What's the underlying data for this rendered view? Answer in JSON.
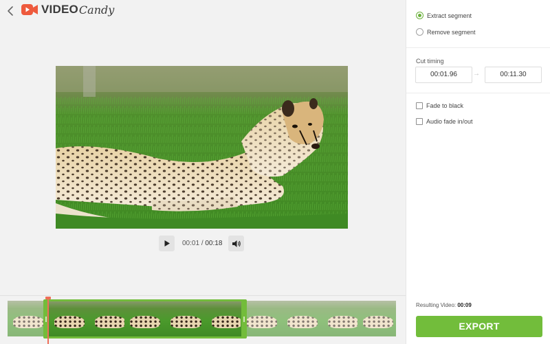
{
  "app": {
    "brand_part1": "VIDEO",
    "brand_part2": "Candy",
    "accent_color": "#72bd3b",
    "logo_color": "#ee5a3d"
  },
  "player": {
    "current_time": "00:01",
    "separator": "/",
    "duration": "00:18",
    "play_icon": "play-icon",
    "volume_icon": "volume-icon"
  },
  "panel": {
    "mode_options": [
      {
        "label": "Extract segment",
        "selected": true
      },
      {
        "label": "Remove segment",
        "selected": false
      }
    ],
    "cut_timing": {
      "title": "Cut timing",
      "start": "00:01.96",
      "arrow": "→",
      "end": "00:11.30"
    },
    "effects": [
      {
        "label": "Fade to black",
        "checked": false
      },
      {
        "label": "Audio fade in/out",
        "checked": false
      }
    ],
    "result_label": "Resulting Video:",
    "result_value": "00:09",
    "export_label": "EXPORT"
  },
  "timeline": {
    "frames": 10
  }
}
